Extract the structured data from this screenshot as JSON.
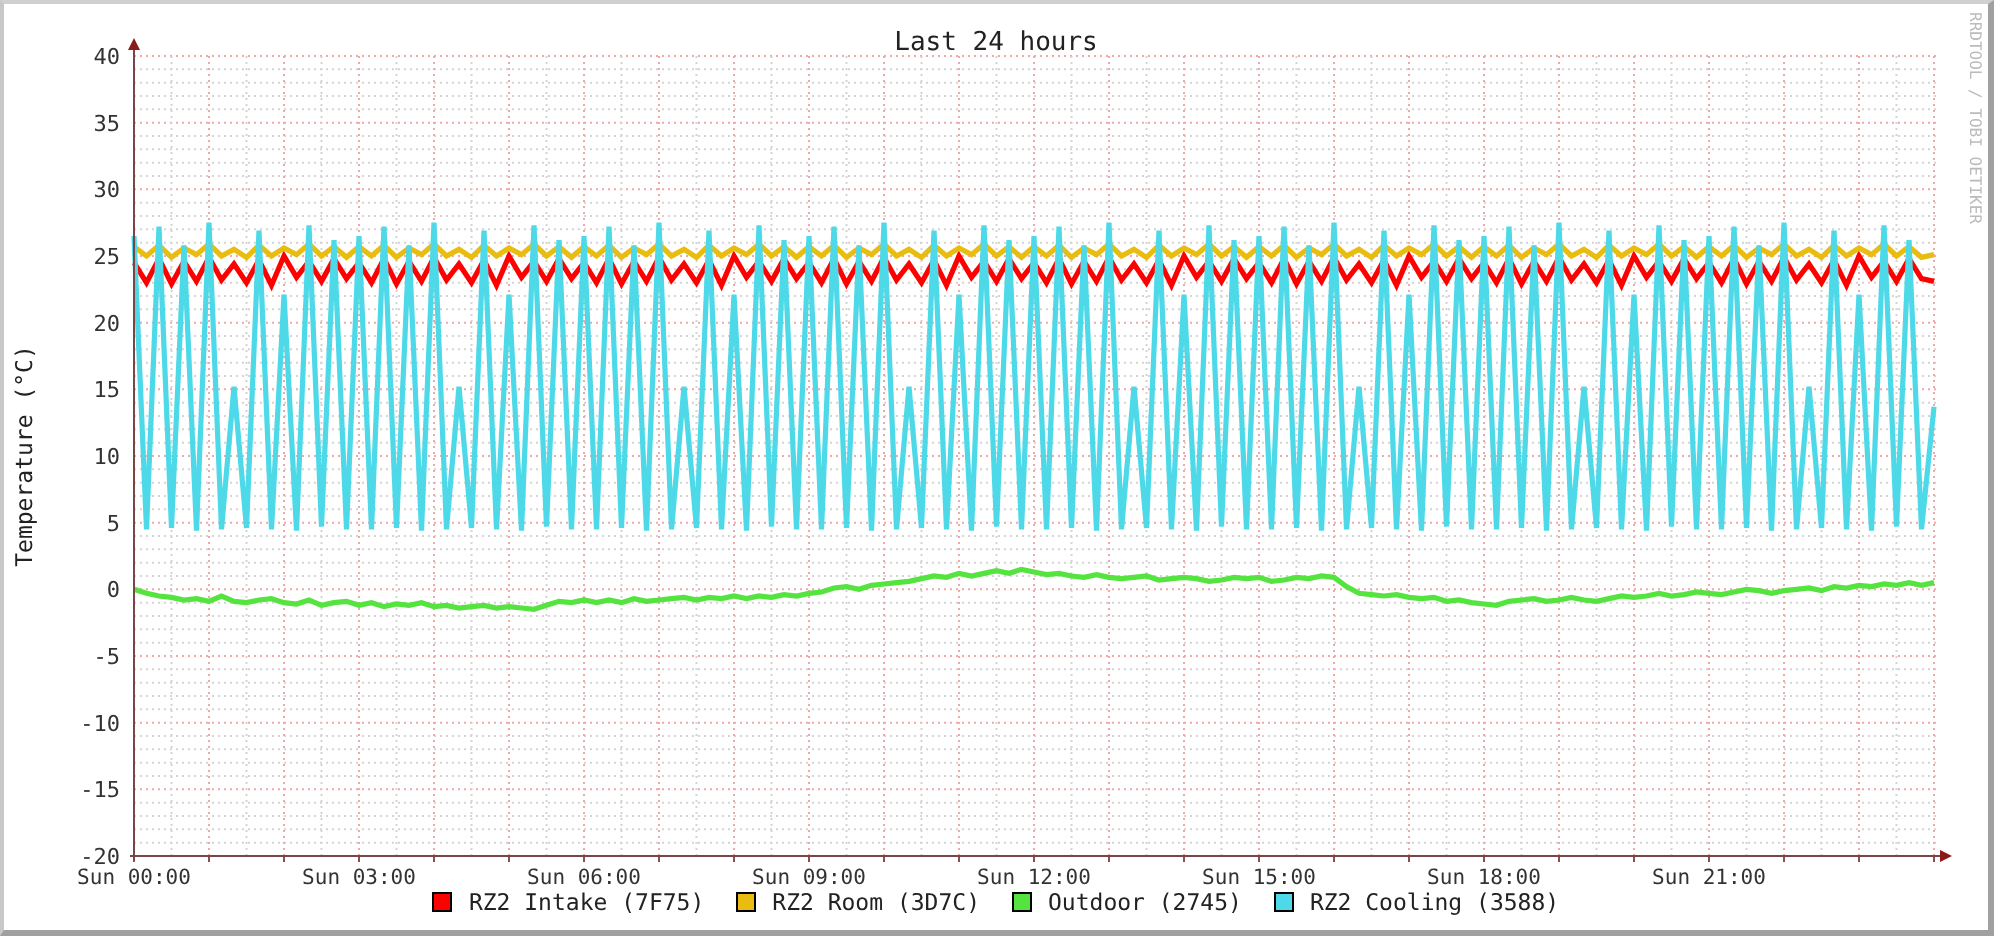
{
  "graph": {
    "credit": "RRDTOOL / TOBI OETIKER",
    "chart_data": {
      "type": "line",
      "title": "Last 24 hours",
      "ylabel": "Temperature (°C)",
      "ylim": [
        -20,
        40
      ],
      "yticks": [
        -20,
        -15,
        -10,
        -5,
        0,
        5,
        10,
        15,
        20,
        25,
        30,
        35,
        40
      ],
      "categories": [
        "Sun 00:00",
        null,
        null,
        null,
        null,
        null,
        null,
        null,
        null,
        null,
        null,
        null,
        null,
        null,
        null,
        null,
        null,
        null,
        "Sun 03:00",
        null,
        null,
        null,
        null,
        null,
        null,
        null,
        null,
        null,
        null,
        null,
        null,
        null,
        null,
        null,
        null,
        null,
        "Sun 06:00",
        null,
        null,
        null,
        null,
        null,
        null,
        null,
        null,
        null,
        null,
        null,
        null,
        null,
        null,
        null,
        null,
        null,
        "Sun 09:00",
        null,
        null,
        null,
        null,
        null,
        null,
        null,
        null,
        null,
        null,
        null,
        null,
        null,
        null,
        null,
        null,
        null,
        "Sun 12:00",
        null,
        null,
        null,
        null,
        null,
        null,
        null,
        null,
        null,
        null,
        null,
        null,
        null,
        null,
        null,
        null,
        null,
        "Sun 15:00",
        null,
        null,
        null,
        null,
        null,
        null,
        null,
        null,
        null,
        null,
        null,
        null,
        null,
        null,
        null,
        null,
        null,
        "Sun 18:00",
        null,
        null,
        null,
        null,
        null,
        null,
        null,
        null,
        null,
        null,
        null,
        null,
        null,
        null,
        null,
        null,
        null,
        "Sun 21:00",
        null,
        null,
        null,
        null,
        null,
        null,
        null,
        null,
        null,
        null,
        null,
        null,
        null,
        null,
        null,
        null,
        null,
        null
      ],
      "grid": true,
      "series": [
        {
          "name": "RZ2 Intake (7F75)",
          "color": "#ff0000",
          "values": [
            24.5,
            23,
            24.8,
            22.9,
            24.6,
            23.1,
            24.9,
            23.2,
            24.4,
            23,
            24.7,
            22.8,
            25,
            23.4,
            24.6,
            23.1,
            24.8,
            23.3,
            24.5,
            23,
            24.8,
            22.9,
            24.6,
            23.1,
            24.9,
            23.2,
            24.4,
            23,
            24.7,
            22.8,
            25,
            23.4,
            24.6,
            23.1,
            24.8,
            23.3,
            24.5,
            23,
            24.8,
            22.9,
            24.6,
            23.1,
            24.9,
            23.2,
            24.4,
            23,
            24.7,
            22.8,
            25,
            23.4,
            24.6,
            23.1,
            24.8,
            23.3,
            24.5,
            23,
            24.8,
            22.9,
            24.6,
            23.1,
            24.9,
            23.2,
            24.4,
            23,
            24.7,
            22.8,
            25,
            23.4,
            24.6,
            23.1,
            24.8,
            23.3,
            24.5,
            23,
            24.8,
            22.9,
            24.6,
            23.1,
            24.9,
            23.2,
            24.4,
            23,
            24.7,
            22.8,
            25,
            23.4,
            24.6,
            23.1,
            24.8,
            23.3,
            24.5,
            23,
            24.8,
            22.9,
            24.6,
            23.1,
            24.9,
            23.2,
            24.4,
            23,
            24.7,
            22.8,
            25,
            23.4,
            24.6,
            23.1,
            24.8,
            23.3,
            24.5,
            23,
            24.8,
            22.9,
            24.6,
            23.1,
            24.9,
            23.2,
            24.4,
            23,
            24.7,
            22.8,
            25,
            23.4,
            24.6,
            23.1,
            24.8,
            23.3,
            24.5,
            23,
            24.8,
            22.9,
            24.6,
            23.1,
            24.9,
            23.2,
            24.4,
            23,
            24.7,
            22.8,
            25,
            23.4,
            24.6,
            23.1,
            24.8,
            23.3,
            23.1
          ]
        },
        {
          "name": "RZ2 Room (3D7C)",
          "color": "#e8bd10",
          "values": [
            25.7,
            25,
            25.8,
            24.9,
            25.6,
            25.1,
            25.9,
            25,
            25.5,
            24.9,
            25.8,
            25,
            25.6,
            25.1,
            25.9,
            25,
            25.7,
            24.9,
            25.7,
            25,
            25.8,
            24.9,
            25.6,
            25.1,
            25.9,
            25,
            25.5,
            24.9,
            25.8,
            25,
            25.6,
            25.1,
            25.9,
            25,
            25.7,
            24.9,
            25.7,
            25,
            25.8,
            24.9,
            25.6,
            25.1,
            25.9,
            25,
            25.5,
            24.9,
            25.8,
            25,
            25.6,
            25.1,
            25.9,
            25,
            25.7,
            24.9,
            25.7,
            25,
            25.8,
            24.9,
            25.6,
            25.1,
            25.9,
            25,
            25.5,
            24.9,
            25.8,
            25,
            25.6,
            25.1,
            25.9,
            25,
            25.7,
            24.9,
            25.7,
            25,
            25.8,
            24.9,
            25.6,
            25.1,
            25.9,
            25,
            25.5,
            24.9,
            25.8,
            25,
            25.6,
            25.1,
            25.9,
            25,
            25.7,
            24.9,
            25.7,
            25,
            25.8,
            24.9,
            25.6,
            25.1,
            25.9,
            25,
            25.5,
            24.9,
            25.8,
            25,
            25.6,
            25.1,
            25.9,
            25,
            25.7,
            24.9,
            25.7,
            25,
            25.8,
            24.9,
            25.6,
            25.1,
            25.9,
            25,
            25.5,
            24.9,
            25.8,
            25,
            25.6,
            25.1,
            25.9,
            25,
            25.7,
            24.9,
            25.7,
            25,
            25.8,
            24.9,
            25.6,
            25.1,
            25.9,
            25,
            25.5,
            24.9,
            25.8,
            25,
            25.6,
            25.1,
            25.9,
            25,
            25.7,
            24.9,
            25.1
          ]
        },
        {
          "name": "Outdoor (2745)",
          "color": "#55e33f",
          "values": [
            0,
            -0.3,
            -0.5,
            -0.6,
            -0.8,
            -0.7,
            -0.9,
            -0.5,
            -0.9,
            -1,
            -0.8,
            -0.7,
            -1,
            -1.1,
            -0.8,
            -1.2,
            -1,
            -0.9,
            -1.2,
            -1,
            -1.3,
            -1.1,
            -1.2,
            -1,
            -1.3,
            -1.2,
            -1.4,
            -1.3,
            -1.2,
            -1.4,
            -1.3,
            -1.4,
            -1.5,
            -1.2,
            -0.9,
            -1,
            -0.8,
            -1,
            -0.8,
            -1,
            -0.7,
            -0.9,
            -0.8,
            -0.7,
            -0.6,
            -0.8,
            -0.6,
            -0.7,
            -0.5,
            -0.7,
            -0.5,
            -0.6,
            -0.4,
            -0.5,
            -0.3,
            -0.2,
            0.1,
            0.2,
            0,
            0.3,
            0.4,
            0.5,
            0.6,
            0.8,
            1,
            0.9,
            1.2,
            1,
            1.2,
            1.4,
            1.2,
            1.5,
            1.3,
            1.1,
            1.2,
            1,
            0.9,
            1.1,
            0.9,
            0.8,
            0.9,
            1,
            0.7,
            0.8,
            0.9,
            0.8,
            0.6,
            0.7,
            0.9,
            0.8,
            0.9,
            0.6,
            0.7,
            0.9,
            0.8,
            1,
            0.9,
            0.2,
            -0.3,
            -0.4,
            -0.5,
            -0.4,
            -0.6,
            -0.7,
            -0.6,
            -0.9,
            -0.8,
            -1,
            -1.1,
            -1.2,
            -0.9,
            -0.8,
            -0.7,
            -0.9,
            -0.8,
            -0.6,
            -0.8,
            -0.9,
            -0.7,
            -0.5,
            -0.6,
            -0.5,
            -0.3,
            -0.5,
            -0.4,
            -0.2,
            -0.3,
            -0.4,
            -0.2,
            0,
            -0.1,
            -0.3,
            -0.1,
            0,
            0.1,
            -0.1,
            0.2,
            0.1,
            0.3,
            0.2,
            0.4,
            0.3,
            0.5,
            0.3,
            0.5
          ]
        },
        {
          "name": "RZ2 Cooling (3588)",
          "color": "#4dd9e8",
          "values": [
            26.5,
            4.5,
            27.2,
            4.6,
            25.8,
            4.4,
            27.5,
            4.5,
            15.2,
            4.6,
            26.9,
            4.5,
            22.1,
            4.4,
            27.3,
            4.7,
            26.2,
            4.5,
            26.5,
            4.5,
            27.2,
            4.6,
            25.8,
            4.4,
            27.5,
            4.5,
            15.2,
            4.6,
            26.9,
            4.5,
            22.1,
            4.4,
            27.3,
            4.7,
            26.2,
            4.5,
            26.5,
            4.5,
            27.2,
            4.6,
            25.8,
            4.4,
            27.5,
            4.5,
            15.2,
            4.6,
            26.9,
            4.5,
            22.1,
            4.4,
            27.3,
            4.7,
            26.2,
            4.5,
            26.5,
            4.5,
            27.2,
            4.6,
            25.8,
            4.4,
            27.5,
            4.5,
            15.2,
            4.6,
            26.9,
            4.5,
            22.1,
            4.4,
            27.3,
            4.7,
            26.2,
            4.5,
            26.5,
            4.5,
            27.2,
            4.6,
            25.8,
            4.4,
            27.5,
            4.5,
            15.2,
            4.6,
            26.9,
            4.5,
            22.1,
            4.4,
            27.3,
            4.7,
            26.2,
            4.5,
            26.5,
            4.5,
            27.2,
            4.6,
            25.8,
            4.4,
            27.5,
            4.5,
            15.2,
            4.6,
            26.9,
            4.5,
            22.1,
            4.4,
            27.3,
            4.7,
            26.2,
            4.5,
            26.5,
            4.5,
            27.2,
            4.6,
            25.8,
            4.4,
            27.5,
            4.5,
            15.2,
            4.6,
            26.9,
            4.5,
            22.1,
            4.4,
            27.3,
            4.7,
            26.2,
            4.5,
            26.5,
            4.5,
            27.2,
            4.6,
            25.8,
            4.4,
            27.5,
            4.5,
            15.2,
            4.6,
            26.9,
            4.5,
            22.1,
            4.4,
            27.3,
            4.7,
            26.2,
            4.5,
            13.7
          ]
        }
      ]
    }
  }
}
